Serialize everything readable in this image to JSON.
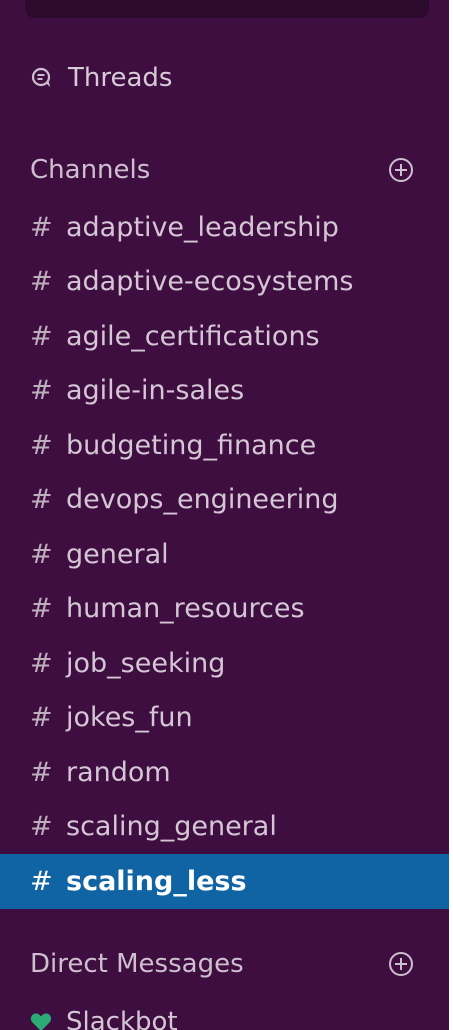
{
  "threads": {
    "label": "Threads",
    "icon": "threads-icon"
  },
  "channels": {
    "title": "Channels",
    "add_icon": "add-circle-icon",
    "hash_symbol": "#",
    "items": [
      {
        "name": "adaptive_leadership"
      },
      {
        "name": "adaptive-ecosystems"
      },
      {
        "name": "agile_certifications"
      },
      {
        "name": "agile-in-sales"
      },
      {
        "name": "budgeting_finance"
      },
      {
        "name": "devops_engineering"
      },
      {
        "name": "general"
      },
      {
        "name": "human_resources"
      },
      {
        "name": "job_seeking"
      },
      {
        "name": "jokes_fun"
      },
      {
        "name": "random"
      },
      {
        "name": "scaling_general"
      },
      {
        "name": "scaling_less",
        "active": true
      }
    ]
  },
  "direct_messages": {
    "title": "Direct Messages",
    "add_icon": "add-circle-icon",
    "items": [
      {
        "name": "Slackbot",
        "presence_icon": "heart-icon",
        "presence_color": "#2bac76"
      }
    ]
  },
  "colors": {
    "sidebar_bg": "#3f0e40",
    "active_bg": "#1164a3",
    "text": "#d4c6d4"
  }
}
